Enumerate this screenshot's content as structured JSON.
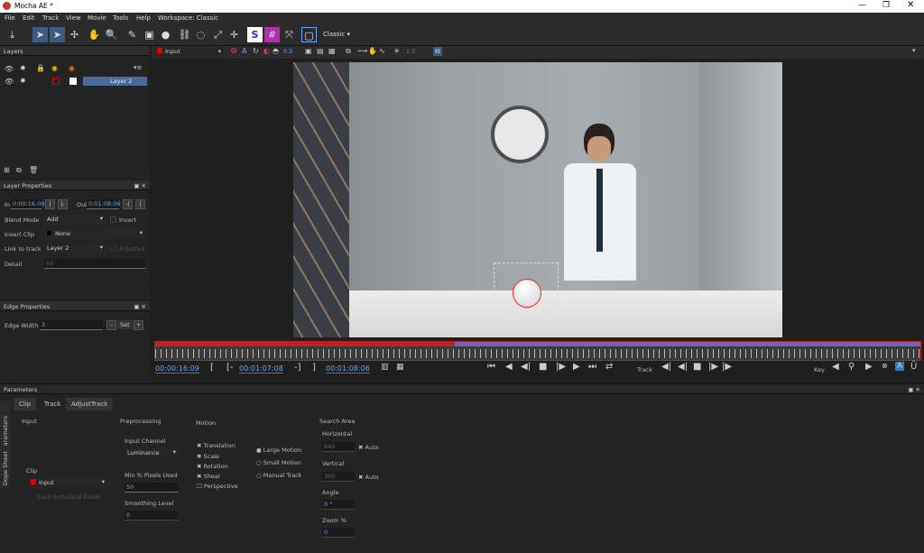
{
  "title": "Mocha AE *",
  "menu": [
    "File",
    "Edit",
    "Track",
    "View",
    "Movie",
    "Tools",
    "Help",
    "Workspace: Classic"
  ],
  "toolbar": {
    "workspace": "Classic"
  },
  "viewer": {
    "input_label": "Input",
    "zoom": "0.5",
    "opacity": "1.0"
  },
  "layers": {
    "header": "Layers",
    "row": "Layer 2"
  },
  "layer_props": {
    "header": "Layer Properties",
    "in_label": "In",
    "in_value": "0:00:16:09",
    "out_label": "Out",
    "out_value": "0:01:08:06",
    "blend_label": "Blend Mode",
    "blend_value": "Add",
    "invert": "Invert",
    "insert_label": "Insert Clip",
    "insert_value": "None",
    "link_label": "Link to track",
    "link_value": "Layer 2",
    "adjusted": "Adjusted",
    "detail_label": "Detail",
    "detail_value": "50"
  },
  "edge_props": {
    "header": "Edge Properties",
    "width_label": "Edge Width",
    "width_value": "3",
    "set": "Set"
  },
  "timeline": {
    "current": "00:00:16:09",
    "in": "00:01:07:08",
    "out": "00:01:08:06",
    "track": "Track",
    "key": "Key"
  },
  "params": {
    "header": "Parameters",
    "tabs": [
      "Clip",
      "Track",
      "AdjustTrack"
    ],
    "side_tabs": [
      "Parameters",
      "Dope Sheet"
    ],
    "input": "Input",
    "clip": "Clip",
    "clip_value": "Input",
    "track_individual": "Track Individual Fields",
    "preprocessing": "Preprocessing",
    "input_channel": "Input Channel",
    "channel_value": "Luminance",
    "min_pixels": "Min % Pixels Used",
    "min_value": "50",
    "smoothing": "Smoothing Level",
    "smoothing_value": "0",
    "motion": "Motion",
    "motions": [
      "Translation",
      "Scale",
      "Rotation",
      "Shear",
      "Perspective"
    ],
    "motion_types": [
      "Large Motion",
      "Small Motion",
      "Manual Track"
    ],
    "search": "Search Area",
    "horizontal": "Horizontal",
    "h_value": "640",
    "auto": "Auto",
    "vertical": "Vertical",
    "v_value": "360",
    "angle": "Angle",
    "angle_value": "0 °",
    "zoom": "Zoom %",
    "zoom_value": "0"
  }
}
